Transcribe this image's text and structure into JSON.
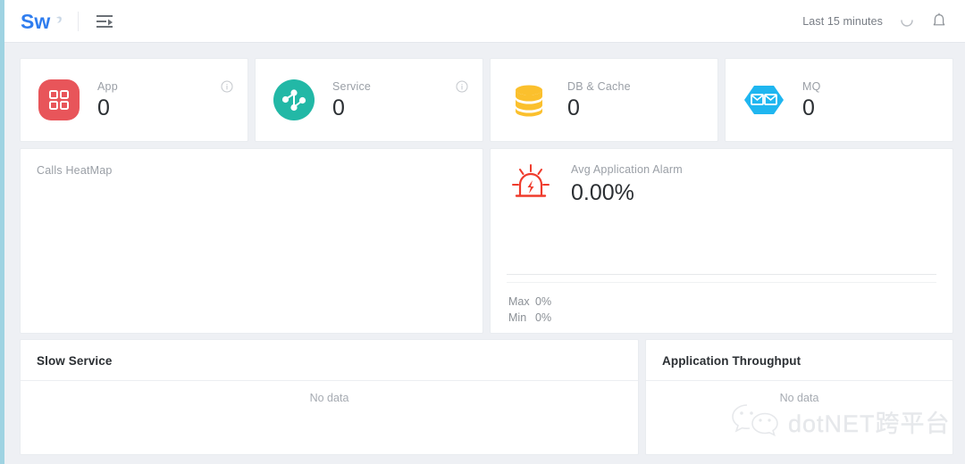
{
  "header": {
    "logo_text": "Sw",
    "logo_alt": "skywalking-logo",
    "menu_icon": "menu-collapse-icon",
    "time_range": "Last 15 minutes",
    "refresh_icon": "refresh-icon",
    "bell_icon": "bell-icon"
  },
  "stats": [
    {
      "label": "App",
      "value": "0",
      "icon": "app-grid-icon",
      "color": "#e8555a",
      "has_info": true
    },
    {
      "label": "Service",
      "value": "0",
      "icon": "service-node-icon",
      "color": "#22b8a6",
      "has_info": true
    },
    {
      "label": "DB & Cache",
      "value": "0",
      "icon": "database-icon",
      "color": "#fbc02d",
      "has_info": false
    },
    {
      "label": "MQ",
      "value": "0",
      "icon": "mq-hexagon-icon",
      "color": "#1fb6f0",
      "has_info": false
    }
  ],
  "heatmap": {
    "title": "Calls HeatMap"
  },
  "alarm": {
    "label": "Avg Application Alarm",
    "value": "0.00%",
    "icon": "alarm-siren-icon",
    "icon_color": "#ef3b2c",
    "max_key": "Max",
    "max_value": "0%",
    "min_key": "Min",
    "min_value": "0%"
  },
  "panels": [
    {
      "title": "Slow Service",
      "empty_text": "No data"
    },
    {
      "title": "Application Throughput",
      "empty_text": "No data"
    }
  ],
  "watermark": {
    "icon": "wechat-icon",
    "text": "dotNET跨平台"
  },
  "colors": {
    "page_background": "#eef0f4",
    "card_background": "#ffffff",
    "left_rail": "#9fd3e2",
    "logo_blue": "#2f7def",
    "text_primary": "#2b2f33",
    "text_muted": "#9a9fa6"
  }
}
